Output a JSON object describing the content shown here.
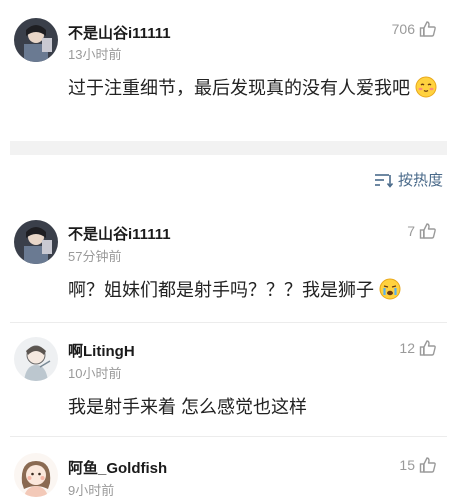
{
  "comments": [
    {
      "username": "不是山谷i11111",
      "time": "13小时前",
      "text": "过于注重细节，最后发现真的没有人爱我吧",
      "likes": "706",
      "emoji": "smile-emoji"
    },
    {
      "username": "不是山谷i11111",
      "time": "57分钟前",
      "text": "啊？姐妹们都是射手吗？？？我是狮子",
      "likes": "7",
      "emoji": "crying-emoji"
    },
    {
      "username": "啊LitingH",
      "time": "10小时前",
      "text": "我是射手来着 怎么感觉也这样",
      "likes": "12"
    },
    {
      "username": "阿鱼_Goldfish",
      "time": "9小时前",
      "likes": "15"
    }
  ],
  "sort": {
    "label": "按热度",
    "icon": "sort-icon"
  }
}
